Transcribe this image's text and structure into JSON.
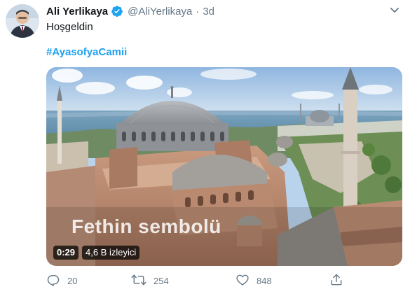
{
  "tweet": {
    "display_name": "Ali Yerlikaya",
    "handle": "@AliYerlikaya",
    "separator": "·",
    "time": "3d",
    "text": "Hoşgeldin",
    "hashtag": "#AyasofyaCamii"
  },
  "video": {
    "subtitle": "Fethin sembolü",
    "duration": "0:29",
    "views": "4,6 B izleyici"
  },
  "actions": {
    "replies": "20",
    "retweets": "254",
    "likes": "848"
  },
  "icons": {
    "verified": "verified-badge-icon",
    "caret": "chevron-down-icon",
    "reply": "reply-icon",
    "retweet": "retweet-icon",
    "like": "heart-icon",
    "share": "share-icon"
  },
  "colors": {
    "accent": "#1da1f2",
    "secondary_text": "#657786"
  }
}
